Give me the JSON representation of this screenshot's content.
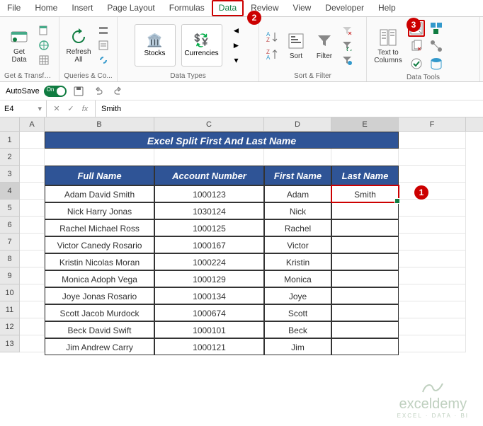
{
  "ribbon": {
    "tabs": [
      "File",
      "Home",
      "Insert",
      "Page Layout",
      "Formulas",
      "Data",
      "Review",
      "View",
      "Developer",
      "Help"
    ],
    "active_tab": "Data",
    "groups": {
      "get_transform": {
        "label": "Get & Transform...",
        "get_data": "Get\nData"
      },
      "queries": {
        "label": "Queries & Co...",
        "refresh_all": "Refresh\nAll"
      },
      "data_types": {
        "label": "Data Types",
        "stocks": "Stocks",
        "currencies": "Currencies"
      },
      "sort_filter": {
        "label": "Sort & Filter",
        "sort": "Sort",
        "filter": "Filter"
      },
      "data_tools": {
        "label": "Data Tools",
        "text_to_columns": "Text to\nColumns"
      }
    }
  },
  "autosave": {
    "label": "AutoSave",
    "on_text": "On"
  },
  "namebox": {
    "value": "E4"
  },
  "formula": {
    "value": "Smith"
  },
  "col_headers": [
    "A",
    "B",
    "C",
    "D",
    "E",
    "F"
  ],
  "row_headers": [
    "1",
    "2",
    "3",
    "4",
    "5",
    "6",
    "7",
    "8",
    "9",
    "10",
    "11",
    "12",
    "13"
  ],
  "table": {
    "title": "Excel Split First And Last Name",
    "headers": {
      "fullname": "Full Name",
      "account": "Account Number",
      "first": "First Name",
      "last": "Last Name"
    },
    "rows": [
      {
        "fullname": "Adam David Smith",
        "account": "1000123",
        "first": "Adam",
        "last": "Smith"
      },
      {
        "fullname": "Nick Harry Jonas",
        "account": "1030124",
        "first": "Nick",
        "last": ""
      },
      {
        "fullname": "Rachel Michael Ross",
        "account": "1000125",
        "first": "Rachel",
        "last": ""
      },
      {
        "fullname": "Victor Canedy Rosario",
        "account": "1000167",
        "first": "Victor",
        "last": ""
      },
      {
        "fullname": "Kristin Nicolas Moran",
        "account": "1000224",
        "first": "Kristin",
        "last": ""
      },
      {
        "fullname": "Monica Adoph Vega",
        "account": "1000129",
        "first": "Monica",
        "last": ""
      },
      {
        "fullname": "Joye Jonas Rosario",
        "account": "1000134",
        "first": "Joye",
        "last": ""
      },
      {
        "fullname": "Scott Jacob Murdock",
        "account": "1000674",
        "first": "Scott",
        "last": ""
      },
      {
        "fullname": "Beck David Swift",
        "account": "1000101",
        "first": "Beck",
        "last": ""
      },
      {
        "fullname": "Jim Andrew Carry",
        "account": "1000121",
        "first": "Jim",
        "last": ""
      }
    ]
  },
  "callouts": {
    "c1": "1",
    "c2": "2",
    "c3": "3"
  },
  "watermark": {
    "main": "exceldemy",
    "sub": "EXCEL · DATA · BI"
  }
}
